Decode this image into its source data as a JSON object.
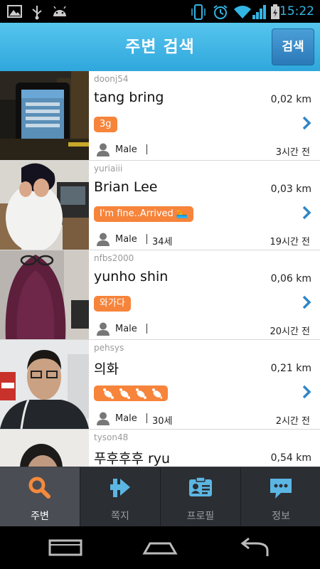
{
  "status_bar": {
    "time": "15:22",
    "left_icons": [
      "image-icon",
      "usb-icon",
      "android-icon"
    ],
    "right_icons": [
      "vibrate-icon",
      "alarm-icon",
      "wifi-icon",
      "signal-icon",
      "battery-icon"
    ]
  },
  "header": {
    "title": "주변 검색",
    "search_button": "검색",
    "accent": "#2fa7dc"
  },
  "list": {
    "tag_color": "#f6843b",
    "items": [
      {
        "user_id": "doonj54",
        "name": "tang bring",
        "distance": "0,02 km",
        "tag": "3g",
        "gender": "Male",
        "age": "",
        "time_ago": "3시간 전"
      },
      {
        "user_id": "yuriaiii",
        "name": "Brian Lee",
        "distance": "0,03 km",
        "tag": "I'm fine..Arrived 🏊",
        "gender": "Male",
        "age": "34세",
        "time_ago": "19시간 전"
      },
      {
        "user_id": "nfbs2000",
        "name": "yunho shin",
        "distance": "0,06 km",
        "tag": "와가다",
        "gender": "Male",
        "age": "",
        "time_ago": "20시간 전"
      },
      {
        "user_id": "pehsys",
        "name": "의화",
        "distance": "0,21 km",
        "tag": "",
        "gender": "Male",
        "age": "30세",
        "time_ago": "2시간 전"
      },
      {
        "user_id": "tyson48",
        "name": "푸후후후 ryu",
        "distance": "0,54 km",
        "tag": "",
        "gender": "",
        "age": "",
        "time_ago": ""
      }
    ]
  },
  "tabs": [
    {
      "label": "주변",
      "icon": "search-icon",
      "active": true
    },
    {
      "label": "쪽지",
      "icon": "message-arrow-icon",
      "active": false
    },
    {
      "label": "프로필",
      "icon": "profile-card-icon",
      "active": false
    },
    {
      "label": "정보",
      "icon": "info-chat-icon",
      "active": false
    }
  ],
  "nav_bar": {
    "icons": [
      "recent-apps-icon",
      "home-icon",
      "back-icon"
    ]
  }
}
